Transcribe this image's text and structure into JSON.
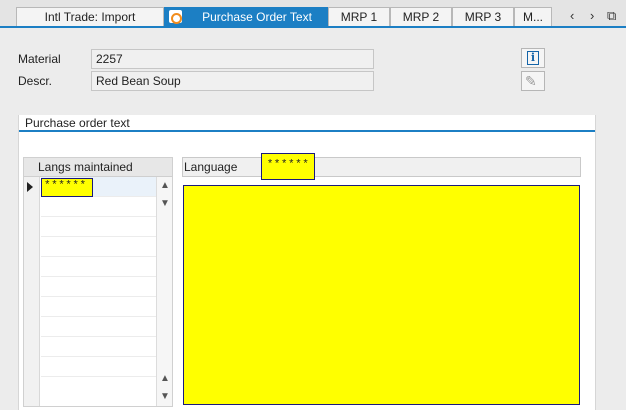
{
  "tabs": [
    {
      "label": "Intl Trade: Import",
      "active": false
    },
    {
      "label": "Purchase Order Text",
      "active": true
    },
    {
      "label": "MRP 1",
      "active": false
    },
    {
      "label": "MRP 2",
      "active": false
    },
    {
      "label": "MRP 3",
      "active": false
    },
    {
      "label": "M...",
      "active": false
    }
  ],
  "nav": {
    "prev": "‹",
    "next": "›",
    "menu": "⧉"
  },
  "header": {
    "material_label": "Material",
    "material_value": "2257",
    "descr_label": "Descr.",
    "descr_value": "Red Bean Soup"
  },
  "panel": {
    "title": "Purchase order text",
    "langs_header": "Langs maintained",
    "langs": [
      "******"
    ],
    "language_label": "Language",
    "language_value": "******",
    "editor_text": ""
  },
  "icons": {
    "info": "info-icon",
    "edit": "edit-icon"
  },
  "colors": {
    "accent": "#1c7fc4",
    "highlight": "#ffff00",
    "outline": "#1a1a7c"
  }
}
